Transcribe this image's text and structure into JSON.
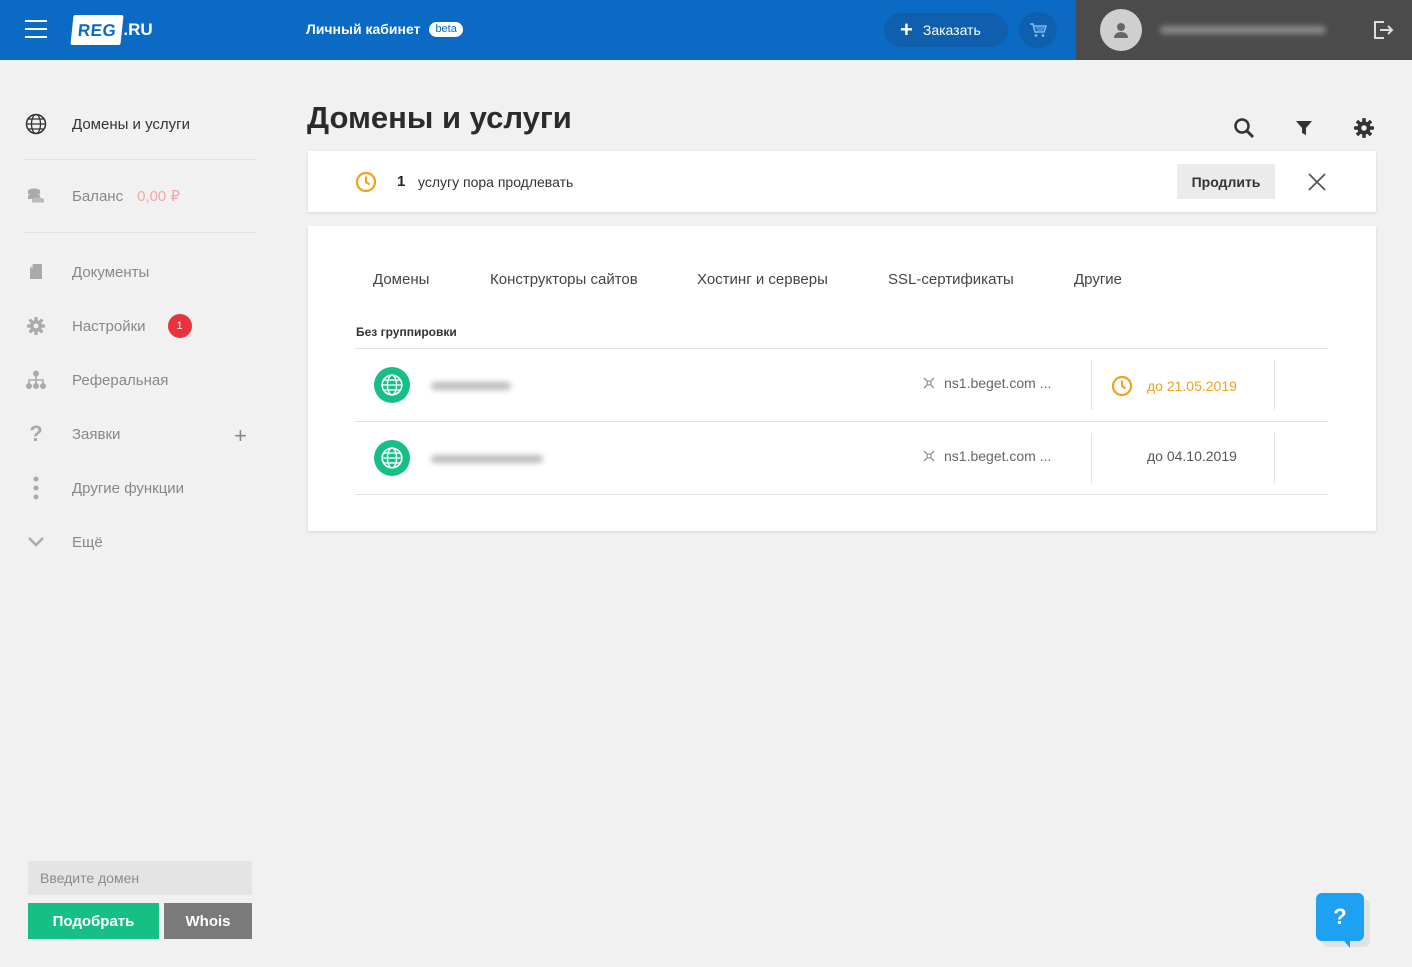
{
  "header": {
    "logo_main": "REG",
    "logo_suffix": ".RU",
    "cabinet_title": "Личный кабинет",
    "beta_label": "beta",
    "order_label": "Заказать",
    "colors": {
      "header_bg": "#0a6ac4",
      "user_bg": "#4b4b4b"
    }
  },
  "sidebar": {
    "items": [
      {
        "label": "Домены и услуги",
        "icon": "globe-icon"
      },
      {
        "label": "Баланс",
        "icon": "coins-icon",
        "value": "0,00 ₽"
      },
      {
        "label": "Документы",
        "icon": "document-icon"
      },
      {
        "label": "Настройки",
        "icon": "gear-icon",
        "badge": "1"
      },
      {
        "label": "Реферальная",
        "icon": "referral-icon"
      },
      {
        "label": "Заявки",
        "icon": "question-icon"
      },
      {
        "label": "Другие функции",
        "icon": "dots-vertical-icon"
      },
      {
        "label": "Ещё",
        "icon": "chevron-down-icon"
      }
    ],
    "domain_search": {
      "placeholder": "Введите домен",
      "pick_label": "Подобрать",
      "whois_label": "Whois"
    }
  },
  "main": {
    "title": "Домены и услуги",
    "notice": {
      "count": "1",
      "text": "услугу пора продлевать",
      "action_label": "Продлить"
    },
    "tabs": [
      {
        "label": "Домены"
      },
      {
        "label": "Конструкторы сайтов"
      },
      {
        "label": "Хостинг и серверы"
      },
      {
        "label": "SSL-сертификаты"
      },
      {
        "label": "Другие"
      }
    ],
    "group_label": "Без группировки",
    "rows": [
      {
        "ns": "ns1.beget.com ...",
        "expiry": "до 21.05.2019",
        "expiring_soon": true
      },
      {
        "ns": "ns1.beget.com ...",
        "expiry": "до 04.10.2019",
        "expiring_soon": false
      }
    ]
  },
  "help": {
    "label": "?"
  }
}
